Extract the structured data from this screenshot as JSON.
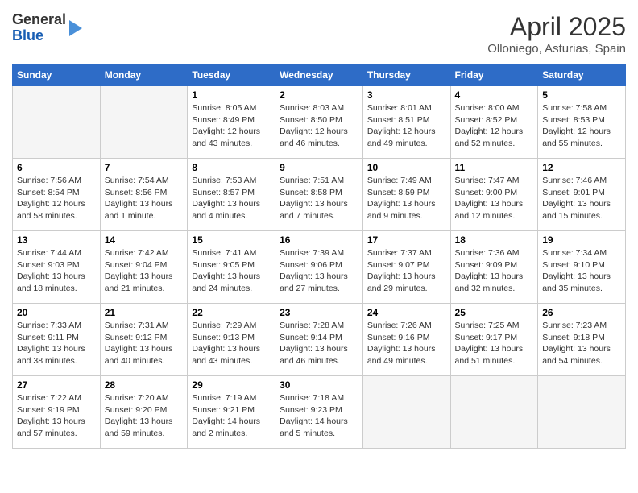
{
  "header": {
    "logo_line1": "General",
    "logo_line2": "Blue",
    "month_year": "April 2025",
    "location": "Olloniego, Asturias, Spain"
  },
  "days_of_week": [
    "Sunday",
    "Monday",
    "Tuesday",
    "Wednesday",
    "Thursday",
    "Friday",
    "Saturday"
  ],
  "weeks": [
    [
      {
        "day": "",
        "info": ""
      },
      {
        "day": "",
        "info": ""
      },
      {
        "day": "1",
        "info": "Sunrise: 8:05 AM\nSunset: 8:49 PM\nDaylight: 12 hours\nand 43 minutes."
      },
      {
        "day": "2",
        "info": "Sunrise: 8:03 AM\nSunset: 8:50 PM\nDaylight: 12 hours\nand 46 minutes."
      },
      {
        "day": "3",
        "info": "Sunrise: 8:01 AM\nSunset: 8:51 PM\nDaylight: 12 hours\nand 49 minutes."
      },
      {
        "day": "4",
        "info": "Sunrise: 8:00 AM\nSunset: 8:52 PM\nDaylight: 12 hours\nand 52 minutes."
      },
      {
        "day": "5",
        "info": "Sunrise: 7:58 AM\nSunset: 8:53 PM\nDaylight: 12 hours\nand 55 minutes."
      }
    ],
    [
      {
        "day": "6",
        "info": "Sunrise: 7:56 AM\nSunset: 8:54 PM\nDaylight: 12 hours\nand 58 minutes."
      },
      {
        "day": "7",
        "info": "Sunrise: 7:54 AM\nSunset: 8:56 PM\nDaylight: 13 hours\nand 1 minute."
      },
      {
        "day": "8",
        "info": "Sunrise: 7:53 AM\nSunset: 8:57 PM\nDaylight: 13 hours\nand 4 minutes."
      },
      {
        "day": "9",
        "info": "Sunrise: 7:51 AM\nSunset: 8:58 PM\nDaylight: 13 hours\nand 7 minutes."
      },
      {
        "day": "10",
        "info": "Sunrise: 7:49 AM\nSunset: 8:59 PM\nDaylight: 13 hours\nand 9 minutes."
      },
      {
        "day": "11",
        "info": "Sunrise: 7:47 AM\nSunset: 9:00 PM\nDaylight: 13 hours\nand 12 minutes."
      },
      {
        "day": "12",
        "info": "Sunrise: 7:46 AM\nSunset: 9:01 PM\nDaylight: 13 hours\nand 15 minutes."
      }
    ],
    [
      {
        "day": "13",
        "info": "Sunrise: 7:44 AM\nSunset: 9:03 PM\nDaylight: 13 hours\nand 18 minutes."
      },
      {
        "day": "14",
        "info": "Sunrise: 7:42 AM\nSunset: 9:04 PM\nDaylight: 13 hours\nand 21 minutes."
      },
      {
        "day": "15",
        "info": "Sunrise: 7:41 AM\nSunset: 9:05 PM\nDaylight: 13 hours\nand 24 minutes."
      },
      {
        "day": "16",
        "info": "Sunrise: 7:39 AM\nSunset: 9:06 PM\nDaylight: 13 hours\nand 27 minutes."
      },
      {
        "day": "17",
        "info": "Sunrise: 7:37 AM\nSunset: 9:07 PM\nDaylight: 13 hours\nand 29 minutes."
      },
      {
        "day": "18",
        "info": "Sunrise: 7:36 AM\nSunset: 9:09 PM\nDaylight: 13 hours\nand 32 minutes."
      },
      {
        "day": "19",
        "info": "Sunrise: 7:34 AM\nSunset: 9:10 PM\nDaylight: 13 hours\nand 35 minutes."
      }
    ],
    [
      {
        "day": "20",
        "info": "Sunrise: 7:33 AM\nSunset: 9:11 PM\nDaylight: 13 hours\nand 38 minutes."
      },
      {
        "day": "21",
        "info": "Sunrise: 7:31 AM\nSunset: 9:12 PM\nDaylight: 13 hours\nand 40 minutes."
      },
      {
        "day": "22",
        "info": "Sunrise: 7:29 AM\nSunset: 9:13 PM\nDaylight: 13 hours\nand 43 minutes."
      },
      {
        "day": "23",
        "info": "Sunrise: 7:28 AM\nSunset: 9:14 PM\nDaylight: 13 hours\nand 46 minutes."
      },
      {
        "day": "24",
        "info": "Sunrise: 7:26 AM\nSunset: 9:16 PM\nDaylight: 13 hours\nand 49 minutes."
      },
      {
        "day": "25",
        "info": "Sunrise: 7:25 AM\nSunset: 9:17 PM\nDaylight: 13 hours\nand 51 minutes."
      },
      {
        "day": "26",
        "info": "Sunrise: 7:23 AM\nSunset: 9:18 PM\nDaylight: 13 hours\nand 54 minutes."
      }
    ],
    [
      {
        "day": "27",
        "info": "Sunrise: 7:22 AM\nSunset: 9:19 PM\nDaylight: 13 hours\nand 57 minutes."
      },
      {
        "day": "28",
        "info": "Sunrise: 7:20 AM\nSunset: 9:20 PM\nDaylight: 13 hours\nand 59 minutes."
      },
      {
        "day": "29",
        "info": "Sunrise: 7:19 AM\nSunset: 9:21 PM\nDaylight: 14 hours\nand 2 minutes."
      },
      {
        "day": "30",
        "info": "Sunrise: 7:18 AM\nSunset: 9:23 PM\nDaylight: 14 hours\nand 5 minutes."
      },
      {
        "day": "",
        "info": ""
      },
      {
        "day": "",
        "info": ""
      },
      {
        "day": "",
        "info": ""
      }
    ]
  ]
}
